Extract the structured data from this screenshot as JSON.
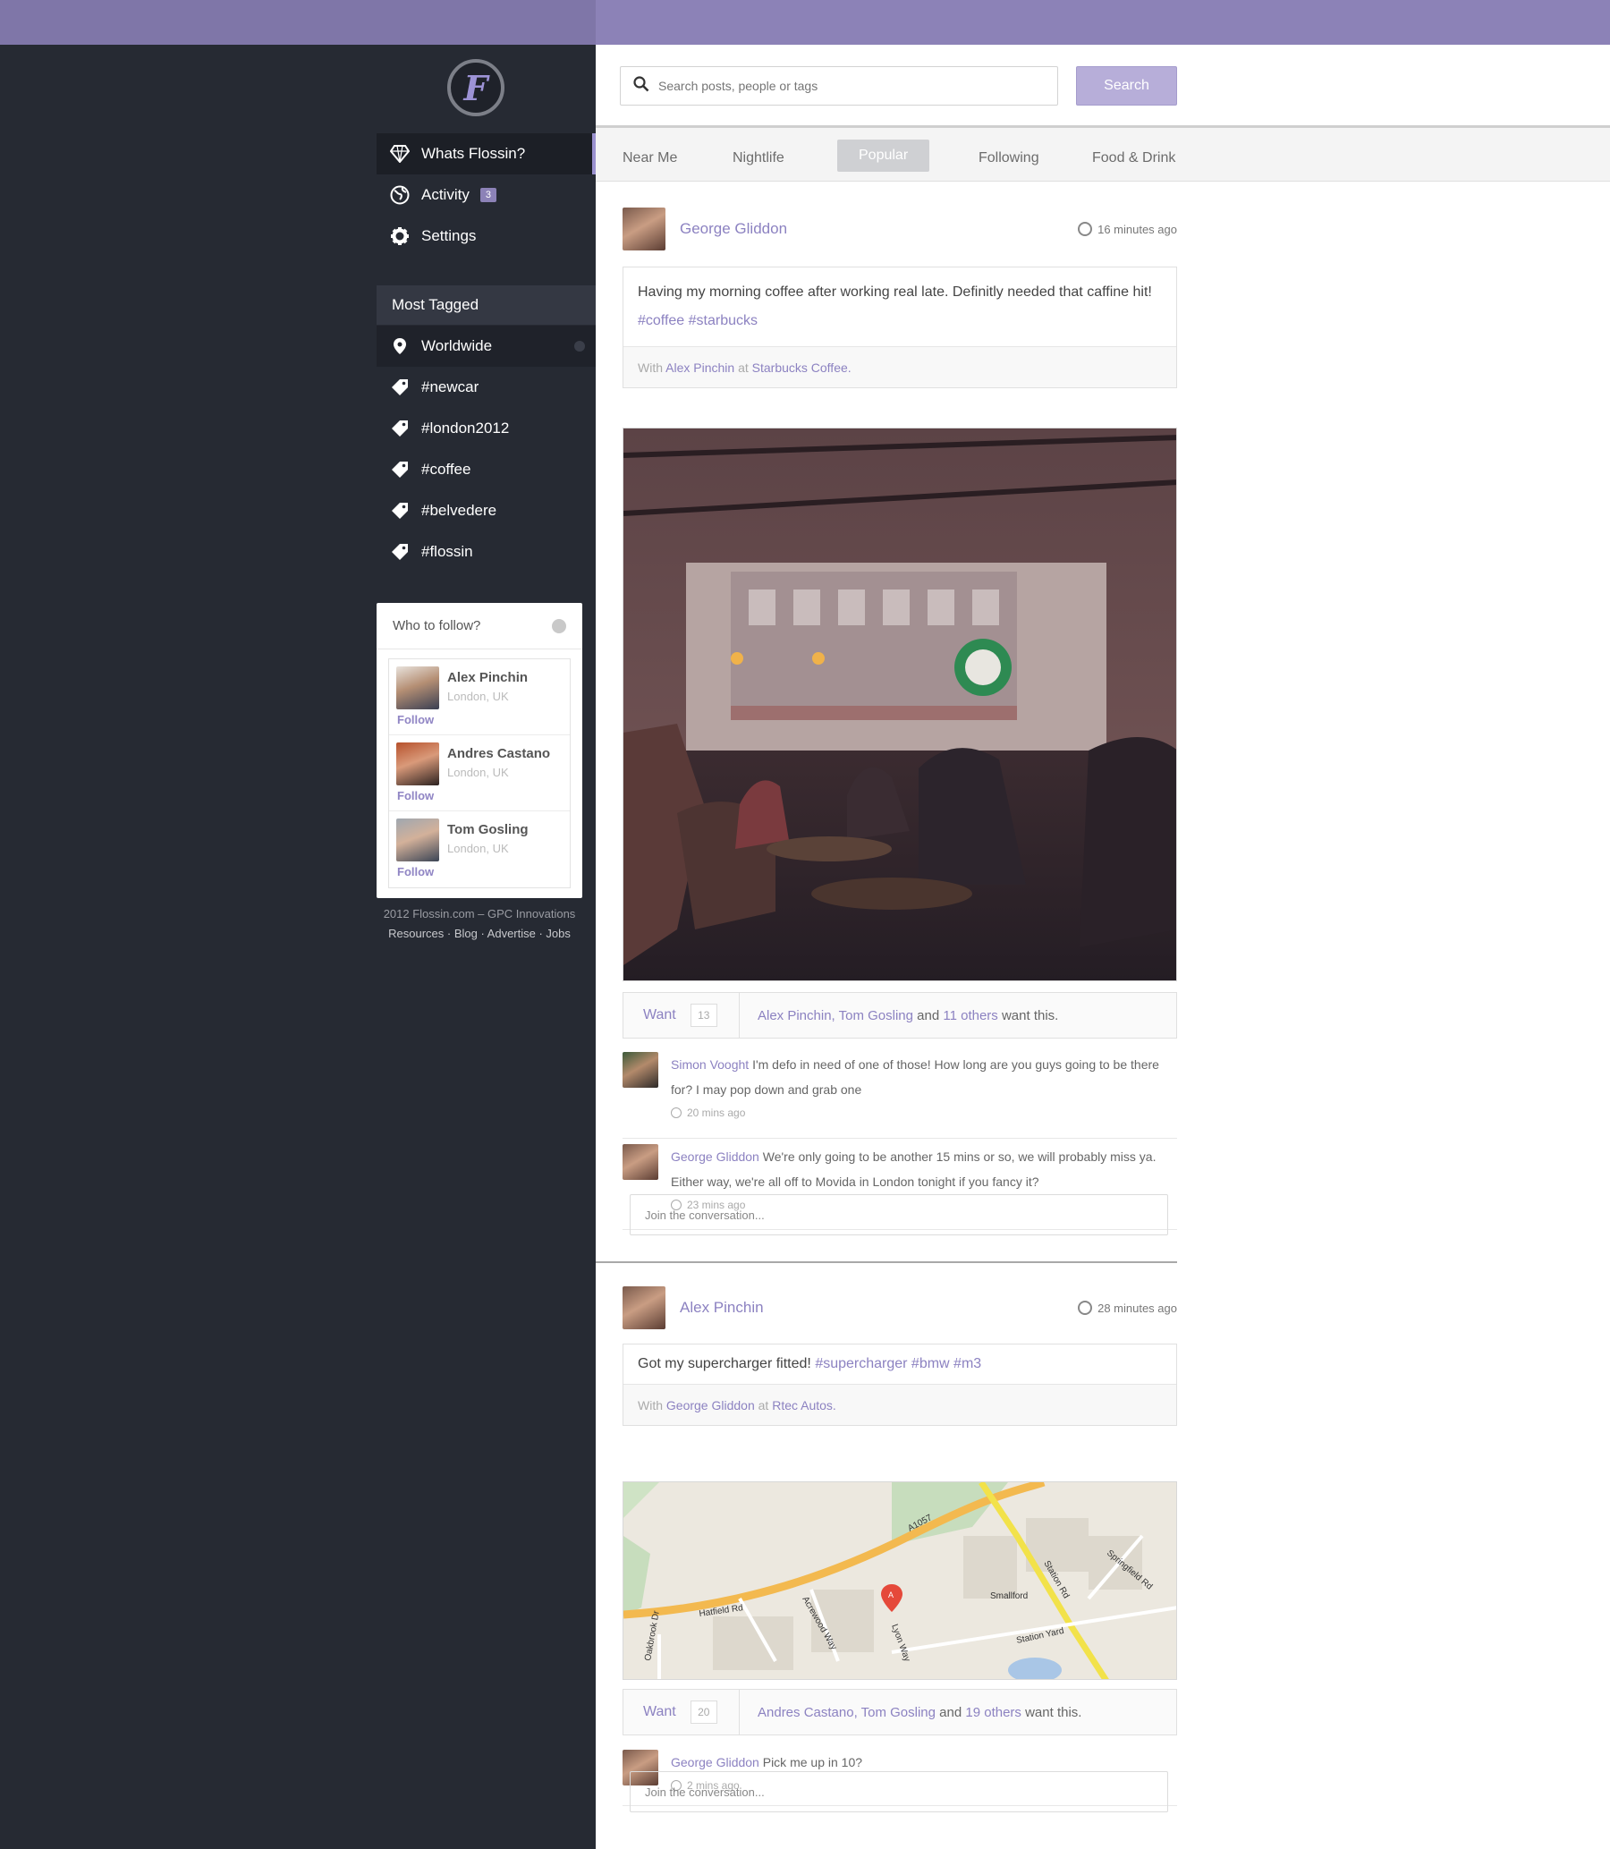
{
  "app": {
    "logo_letter": "F",
    "accent": "#8c82b7"
  },
  "nav": {
    "items": [
      {
        "label": "Whats Flossin?",
        "icon": "diamond-icon"
      },
      {
        "label": "Activity",
        "icon": "globe-icon",
        "badge": "3"
      },
      {
        "label": "Settings",
        "icon": "gear-icon"
      }
    ]
  },
  "most_tagged": {
    "title": "Most Tagged",
    "items": [
      "Worldwide",
      "#newcar",
      "#london2012",
      "#coffee",
      "#belvedere",
      "#flossin"
    ]
  },
  "who_to_follow": {
    "title": "Who to follow?",
    "people": [
      {
        "name": "Alex Pinchin",
        "location": "London, UK",
        "action": "Follow"
      },
      {
        "name": "Andres Castano",
        "location": "London, UK",
        "action": "Follow"
      },
      {
        "name": "Tom Gosling",
        "location": "London, UK",
        "action": "Follow"
      }
    ]
  },
  "footer": {
    "line1": "2012 Flossin.com – GPC Innovations",
    "line2": "Resources · Blog · Advertise · Jobs"
  },
  "search": {
    "placeholder": "Search posts, people or tags",
    "button": "Search"
  },
  "tabs": [
    "Near Me",
    "Nightlife",
    "Popular",
    "Following",
    "Food & Drink"
  ],
  "posts": [
    {
      "author": "George Gliddon",
      "time": "16 minutes ago",
      "text": "Having my morning coffee after working real late. Definitly needed that caffine hit!",
      "hashtags": "#coffee #starbucks",
      "with_prefix": "With",
      "with_person": "Alex Pinchin",
      "at_word": "at",
      "place": "Starbucks Coffee.",
      "want_label": "Want",
      "want_count": "13",
      "want_names": "Alex Pinchin, Tom Gosling",
      "want_and": "and",
      "want_others": "11 others",
      "want_suffix": "want this.",
      "comments": [
        {
          "author": "Simon Vooght",
          "text": "I'm defo in need of one of those! How long are you guys going to be there for? I may pop down and grab one",
          "time": "20 mins ago"
        },
        {
          "author": "George Gliddon",
          "text": "We're only going to be another 15 mins or so, we will probably miss ya. Either way, we're all off to Movida in London tonight if you fancy it?",
          "time": "23 mins ago"
        }
      ],
      "join_placeholder": "Join the conversation..."
    },
    {
      "author": "Alex Pinchin",
      "time": "28 minutes ago",
      "text": "Got my supercharger fitted!",
      "hashtags": "#supercharger #bmw #m3",
      "with_prefix": "With",
      "with_person": "George Gliddon",
      "at_word": "at",
      "place": "Rtec Autos.",
      "map_labels": {
        "road1": "Hatfield Rd",
        "road2": "A1057",
        "road3": "Station Rd",
        "road4": "Springfield Rd",
        "place": "Smallford",
        "station": "Station Yard",
        "street1": "Acrewood Way",
        "street2": "Lyon Way",
        "street3": "Oakbrook Dr",
        "marker": "A"
      },
      "want_label": "Want",
      "want_count": "20",
      "want_names": "Andres Castano, Tom Gosling",
      "want_and": "and",
      "want_others": "19 others",
      "want_suffix": "want this.",
      "comments": [
        {
          "author": "George Gliddon",
          "text": "Pick me up in 10?",
          "time": "2 mins ago"
        }
      ],
      "join_placeholder": "Join the conversation..."
    }
  ]
}
